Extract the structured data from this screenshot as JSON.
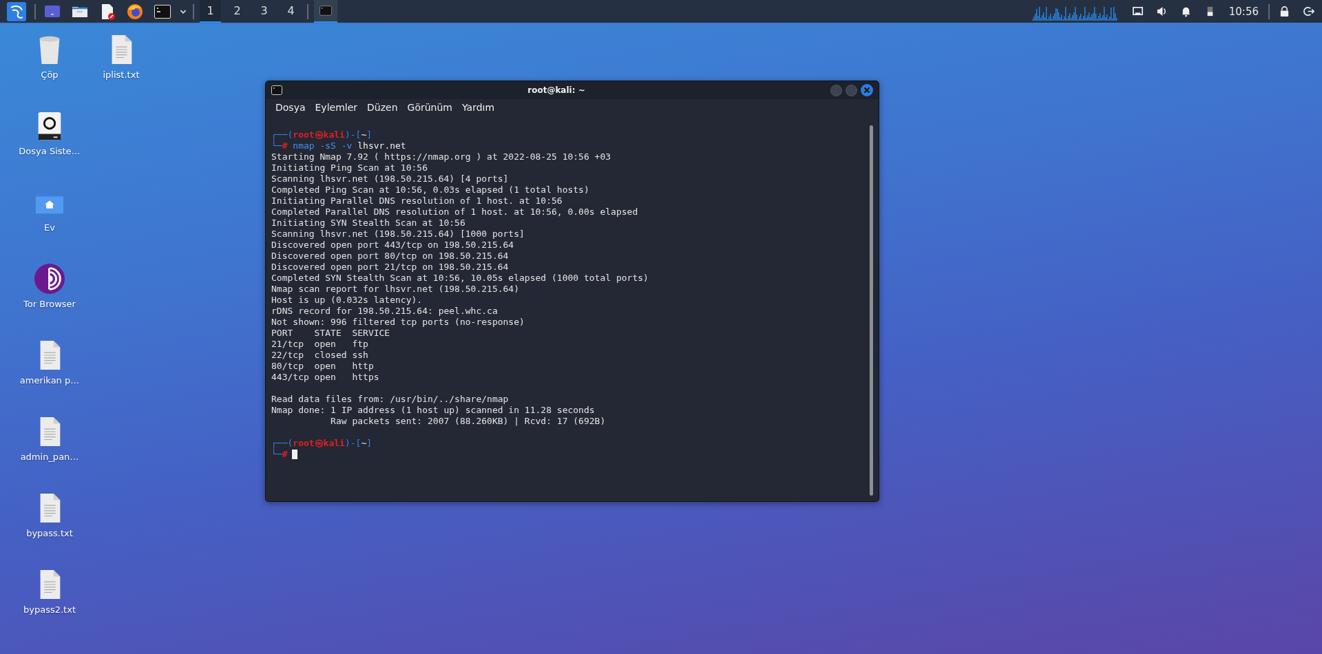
{
  "taskbar": {
    "launchers": [
      {
        "kind": "menu"
      },
      {
        "kind": "desktop"
      },
      {
        "kind": "files"
      },
      {
        "kind": "editor"
      },
      {
        "kind": "browser"
      },
      {
        "kind": "terminal"
      },
      {
        "kind": "dropdown"
      }
    ],
    "workspaces": [
      {
        "label": "1",
        "selected": true
      },
      {
        "label": "2",
        "selected": false
      },
      {
        "label": "3",
        "selected": false
      },
      {
        "label": "4",
        "selected": false
      }
    ],
    "tasks": [
      {
        "kind": "terminal",
        "selected": true
      }
    ],
    "tray": {
      "clock": "10:56"
    }
  },
  "desktop": {
    "icons": [
      {
        "label": "Çöp",
        "kind": "trash"
      },
      {
        "label": "Dosya Siste…",
        "kind": "drive"
      },
      {
        "label": "Ev",
        "kind": "home"
      },
      {
        "label": "Tor Browser",
        "kind": "tor"
      },
      {
        "label": "amerikan p…",
        "kind": "file"
      },
      {
        "label": "admin_pan…",
        "kind": "file"
      },
      {
        "label": "bypass.txt",
        "kind": "file"
      },
      {
        "label": "bypass2.txt",
        "kind": "file"
      },
      {
        "label": "iplist.txt",
        "kind": "file"
      }
    ]
  },
  "terminal": {
    "title": "root@kali: ~",
    "menu": [
      "Dosya",
      "Eylemler",
      "Düzen",
      "Görünüm",
      "Yardım"
    ],
    "lines": [
      {
        "kind": "prompt",
        "open": "┌──(",
        "user": "root",
        "symbol": "㉿",
        "host": "kali",
        "mid": ")-[",
        "dir": "~",
        "close": "]",
        "lead": "└─",
        "sign": "#",
        "command": [
          {
            "kind": "program",
            "text": "nmap"
          },
          {
            "kind": "option",
            "text": "-sS -v"
          },
          {
            "kind": "argument",
            "text": "lhsvr.net"
          }
        ],
        "cursor": false
      },
      {
        "kind": "output",
        "text": "Starting Nmap 7.92 ( https://nmap.org ) at 2022-08-25 10:56 +03"
      },
      {
        "kind": "output",
        "text": "Initiating Ping Scan at 10:56"
      },
      {
        "kind": "output",
        "text": "Scanning lhsvr.net (198.50.215.64) [4 ports]"
      },
      {
        "kind": "output",
        "text": "Completed Ping Scan at 10:56, 0.03s elapsed (1 total hosts)"
      },
      {
        "kind": "output",
        "text": "Initiating Parallel DNS resolution of 1 host. at 10:56"
      },
      {
        "kind": "output",
        "text": "Completed Parallel DNS resolution of 1 host. at 10:56, 0.00s elapsed"
      },
      {
        "kind": "output",
        "text": "Initiating SYN Stealth Scan at 10:56"
      },
      {
        "kind": "output",
        "text": "Scanning lhsvr.net (198.50.215.64) [1000 ports]"
      },
      {
        "kind": "output",
        "text": "Discovered open port 443/tcp on 198.50.215.64"
      },
      {
        "kind": "output",
        "text": "Discovered open port 80/tcp on 198.50.215.64"
      },
      {
        "kind": "output",
        "text": "Discovered open port 21/tcp on 198.50.215.64"
      },
      {
        "kind": "output",
        "text": "Completed SYN Stealth Scan at 10:56, 10.05s elapsed (1000 total ports)"
      },
      {
        "kind": "output",
        "text": "Nmap scan report for lhsvr.net (198.50.215.64)"
      },
      {
        "kind": "output",
        "text": "Host is up (0.032s latency)."
      },
      {
        "kind": "output",
        "text": "rDNS record for 198.50.215.64: peel.whc.ca"
      },
      {
        "kind": "output",
        "text": "Not shown: 996 filtered tcp ports (no-response)"
      },
      {
        "kind": "output",
        "text": "PORT    STATE  SERVICE"
      },
      {
        "kind": "output",
        "text": "21/tcp  open   ftp"
      },
      {
        "kind": "output",
        "text": "22/tcp  closed ssh"
      },
      {
        "kind": "output",
        "text": "80/tcp  open   http"
      },
      {
        "kind": "output",
        "text": "443/tcp open   https"
      },
      {
        "kind": "blank"
      },
      {
        "kind": "output",
        "text": "Read data files from: /usr/bin/../share/nmap"
      },
      {
        "kind": "output",
        "text": "Nmap done: 1 IP address (1 host up) scanned in 11.28 seconds"
      },
      {
        "kind": "output",
        "text": "           Raw packets sent: 2007 (88.260KB) | Rcvd: 17 (692B)"
      },
      {
        "kind": "blank"
      },
      {
        "kind": "prompt",
        "open": "┌──(",
        "user": "root",
        "symbol": "㉿",
        "host": "kali",
        "mid": ")-[",
        "dir": "~",
        "close": "]",
        "lead": "└─",
        "sign": "#",
        "cursor": true
      }
    ]
  }
}
